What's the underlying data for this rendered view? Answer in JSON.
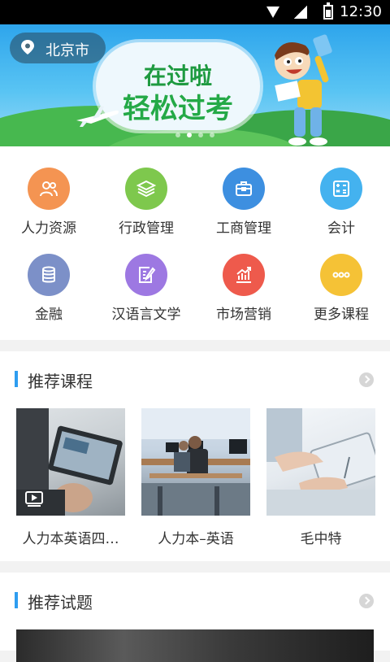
{
  "status_bar": {
    "time": "12:30",
    "icons": [
      "wifi-icon",
      "signal-icon",
      "battery-icon"
    ]
  },
  "banner": {
    "location": "北京市",
    "headline_line1": "在过啦",
    "headline_line2": "轻松过考",
    "slide_count": 4,
    "active_slide": 2
  },
  "categories": [
    {
      "label": "人力资源",
      "icon": "people-icon",
      "color": "#f49452"
    },
    {
      "label": "行政管理",
      "icon": "layers-icon",
      "color": "#7ec84d"
    },
    {
      "label": "工商管理",
      "icon": "briefcase-icon",
      "color": "#3d8fe0"
    },
    {
      "label": "会计",
      "icon": "calculator-icon",
      "color": "#44b2ef"
    },
    {
      "label": "金融",
      "icon": "coins-icon",
      "color": "#7c90c8"
    },
    {
      "label": "汉语言文学",
      "icon": "edit-icon",
      "color": "#9d78e2"
    },
    {
      "label": "市场营销",
      "icon": "chart-icon",
      "color": "#ee5a4c"
    },
    {
      "label": "更多课程",
      "icon": "more-icon",
      "color": "#f5c236"
    }
  ],
  "recommended_courses": {
    "title": "推荐课程",
    "items": [
      {
        "title": "人力本英语四…",
        "has_video": true
      },
      {
        "title": "人力本–英语",
        "has_video": false
      },
      {
        "title": "毛中特",
        "has_video": false
      }
    ]
  },
  "recommended_questions": {
    "title": "推荐试题"
  },
  "colors": {
    "accent": "#2e9df0",
    "banner_sky": "#2ea5ec",
    "grass": "#47b84f"
  }
}
